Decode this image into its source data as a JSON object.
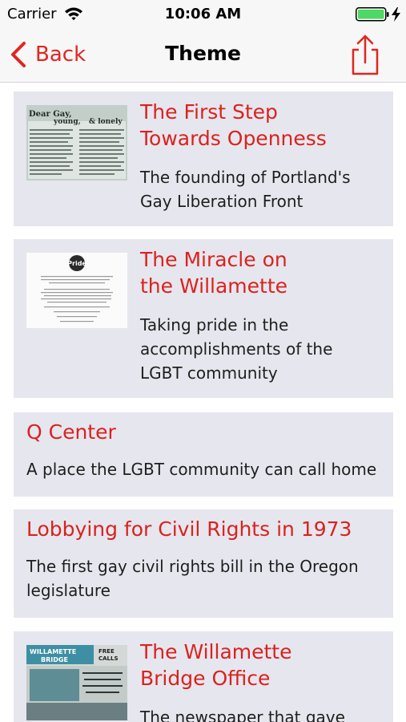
{
  "status_bar": {
    "carrier": "Carrier",
    "time": "10:06 AM"
  },
  "nav": {
    "back_label": "Back",
    "title": "Theme"
  },
  "colors": {
    "accent": "#e0261f",
    "card_background": "#e6e6ee",
    "battery": "#4cd964"
  },
  "cards": [
    {
      "title_lines": [
        "The First Step",
        "Towards Openness"
      ],
      "subtitle_lines": [
        "The founding of Portland's",
        "Gay Liberation Front"
      ],
      "thumbnail": "newsletter-dear-gay-young-lonely",
      "thumbnail_text": [
        "Dear Gay,",
        "young,",
        "& lonely"
      ]
    },
    {
      "title_lines": [
        "The Miracle on",
        "the Willamette"
      ],
      "subtitle_lines": [
        "Taking pride in the",
        "accomplishments of the",
        "LGBT community"
      ],
      "thumbnail": "pride-document",
      "thumbnail_text": [
        "Pride"
      ]
    },
    {
      "title_lines": [
        "Q Center"
      ],
      "subtitle_lines": [
        "A place the LGBT community can call home"
      ]
    },
    {
      "title_lines": [
        "Lobbying for Civil Rights in 1973"
      ],
      "subtitle_lines": [
        "The first gay civil rights bill in the Oregon",
        "legislature"
      ]
    },
    {
      "title_lines": [
        "The Willamette",
        "Bridge Office"
      ],
      "subtitle_lines": [
        "The newspaper that gave"
      ],
      "thumbnail": "willamette-bridge-newspaper",
      "thumbnail_text": [
        "WILLAMETTE",
        "BRIDGE",
        "FREE",
        "CALLS"
      ]
    }
  ]
}
